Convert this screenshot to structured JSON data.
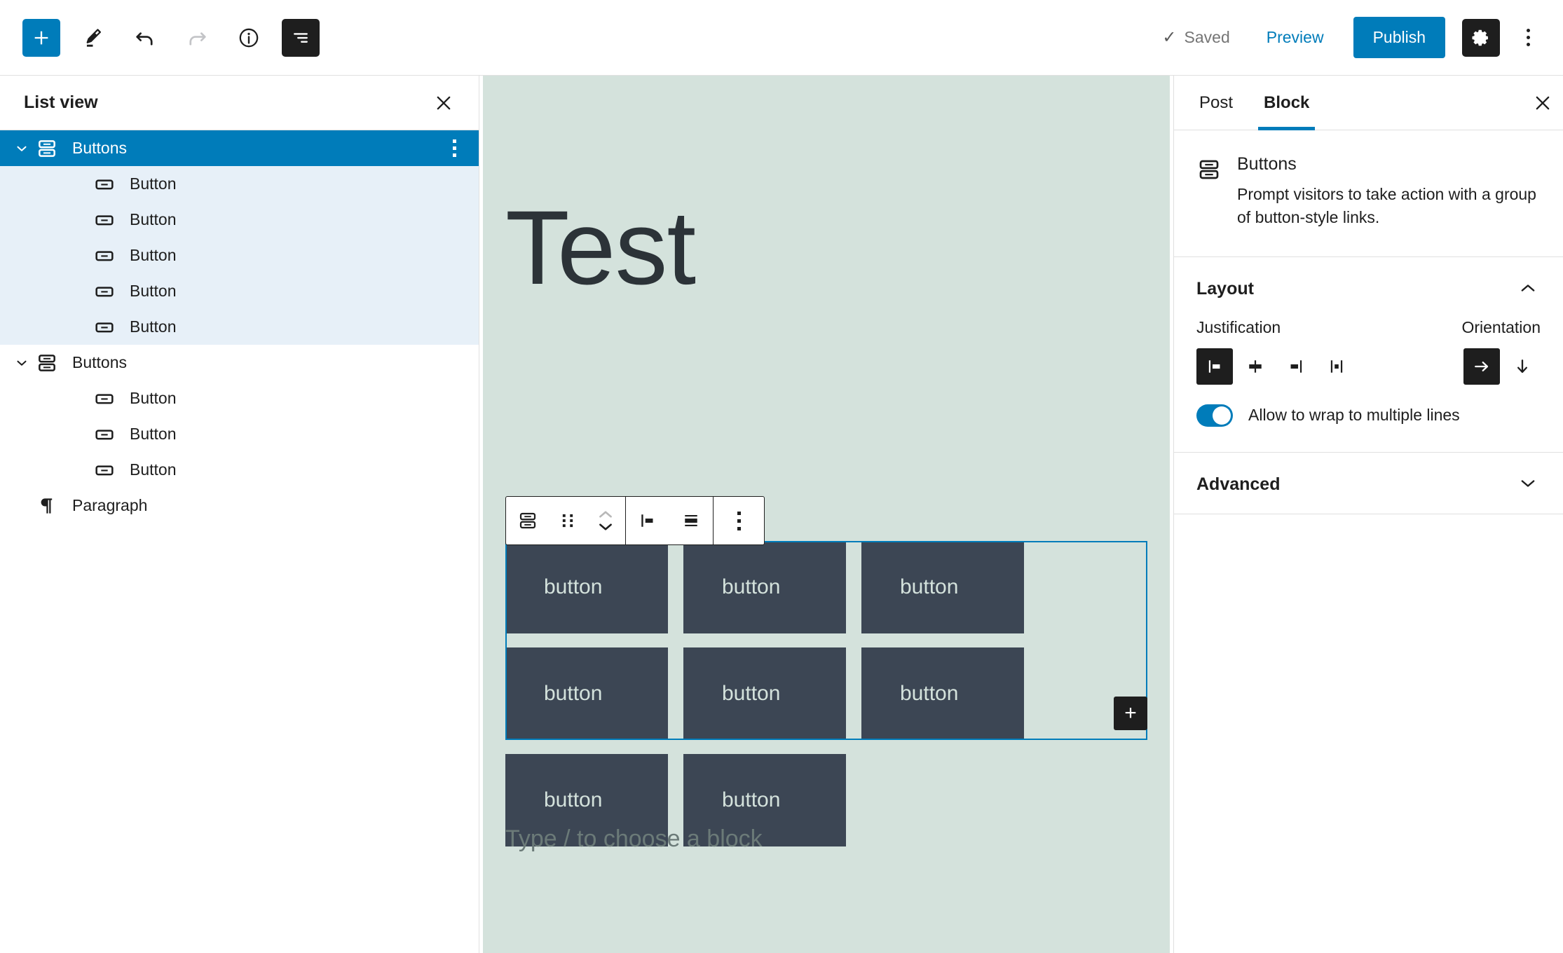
{
  "topbar": {
    "add_block_label": "+",
    "tools_icon": "pencil-icon",
    "undo_icon": "undo-icon",
    "redo_icon": "redo-icon",
    "info_icon": "info-icon",
    "listview_icon": "list-view-icon",
    "saved_label": "Saved",
    "saved_check": "✓",
    "preview_label": "Preview",
    "publish_label": "Publish",
    "settings_icon": "gear-icon",
    "options_icon": "kebab-icon"
  },
  "listview": {
    "title": "List view",
    "close_label": "✕",
    "items": [
      {
        "label": "Buttons",
        "level": 1,
        "icon": "buttons-block-icon",
        "state": "selected",
        "expanded": true,
        "has_kebab": true
      },
      {
        "label": "Button",
        "level": 2,
        "icon": "button-block-icon",
        "state": "child-of-selected",
        "expanded": false,
        "has_kebab": false
      },
      {
        "label": "Button",
        "level": 2,
        "icon": "button-block-icon",
        "state": "child-of-selected",
        "expanded": false,
        "has_kebab": false
      },
      {
        "label": "Button",
        "level": 2,
        "icon": "button-block-icon",
        "state": "child-of-selected",
        "expanded": false,
        "has_kebab": false
      },
      {
        "label": "Button",
        "level": 2,
        "icon": "button-block-icon",
        "state": "child-of-selected",
        "expanded": false,
        "has_kebab": false
      },
      {
        "label": "Button",
        "level": 2,
        "icon": "button-block-icon",
        "state": "child-of-selected",
        "expanded": false,
        "has_kebab": false
      },
      {
        "label": "Buttons",
        "level": 1,
        "icon": "buttons-block-icon",
        "state": "normal",
        "expanded": true,
        "has_kebab": false
      },
      {
        "label": "Button",
        "level": 2,
        "icon": "button-block-icon",
        "state": "normal",
        "expanded": false,
        "has_kebab": false
      },
      {
        "label": "Button",
        "level": 2,
        "icon": "button-block-icon",
        "state": "normal",
        "expanded": false,
        "has_kebab": false
      },
      {
        "label": "Button",
        "level": 2,
        "icon": "button-block-icon",
        "state": "normal",
        "expanded": false,
        "has_kebab": false
      },
      {
        "label": "Paragraph",
        "level": 1,
        "icon": "paragraph-block-icon",
        "state": "normal",
        "expanded": false,
        "has_kebab": false
      }
    ]
  },
  "canvas": {
    "background_color": "#d4e2dc",
    "post_title": "Test",
    "block_toolbar": {
      "block_type_icon": "buttons-block-icon",
      "drag_icon": "drag-handle-icon",
      "move_icon": "move-up-down-icon",
      "justify_icon": "justify-left-icon",
      "vertical_align_icon": "vertical-align-center-icon",
      "options_icon": "kebab-icon"
    },
    "buttons": [
      {
        "label": "button",
        "selected_group": true
      },
      {
        "label": "button",
        "selected_group": true
      },
      {
        "label": "button",
        "selected_group": true
      },
      {
        "label": "button",
        "selected_group": true
      },
      {
        "label": "button",
        "selected_group": true
      },
      {
        "label": "button",
        "selected_group": false
      },
      {
        "label": "button",
        "selected_group": false
      },
      {
        "label": "button",
        "selected_group": false
      }
    ],
    "appender_label": "+",
    "paragraph_placeholder": "Type / to choose a block",
    "button_background": "#3c4654",
    "button_text_color": "#d4e2dc",
    "selection_color": "#007cba"
  },
  "settings": {
    "tabs": [
      {
        "label": "Post",
        "active": false
      },
      {
        "label": "Block",
        "active": true
      }
    ],
    "close_label": "✕",
    "block": {
      "name": "Buttons",
      "description": "Prompt visitors to take action with a group of button-style links.",
      "icon": "buttons-block-icon"
    },
    "layout": {
      "title": "Layout",
      "collapse_icon": "chevron-up-icon",
      "justification_label": "Justification",
      "orientation_label": "Orientation",
      "justification_options": [
        {
          "name": "justify-left",
          "active": true
        },
        {
          "name": "justify-center",
          "active": false
        },
        {
          "name": "justify-right",
          "active": false
        },
        {
          "name": "justify-space-between",
          "active": false
        }
      ],
      "orientation_options": [
        {
          "name": "orientation-horizontal",
          "active": true
        },
        {
          "name": "orientation-vertical",
          "active": false
        }
      ],
      "wrap_toggle_label": "Allow to wrap to multiple lines",
      "wrap_toggle_on": true
    },
    "advanced": {
      "title": "Advanced",
      "expand_icon": "chevron-down-icon"
    },
    "accent_color": "#007cba"
  }
}
